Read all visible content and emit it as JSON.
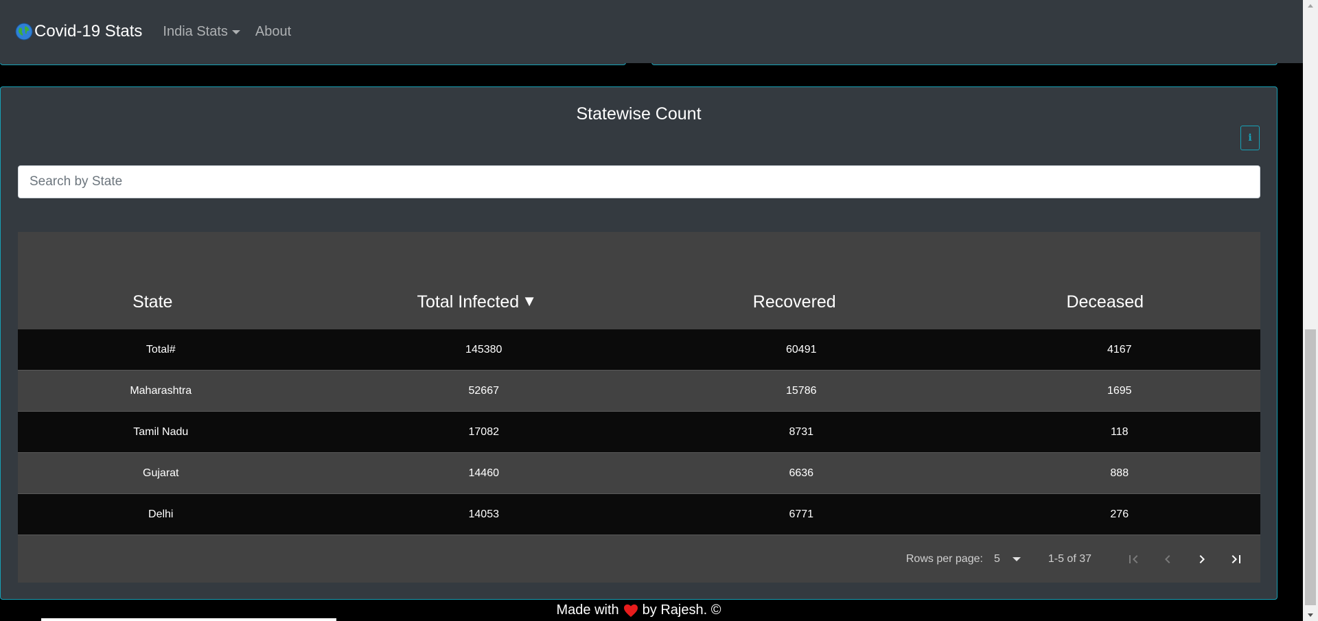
{
  "navbar": {
    "brand": "Covid-19 Stats",
    "items": [
      {
        "label": "India Stats",
        "dropdown": true
      },
      {
        "label": "About",
        "dropdown": false
      }
    ]
  },
  "card": {
    "title": "Statewise Count",
    "info_label": "i",
    "search_placeholder": "Search by State"
  },
  "table": {
    "columns": [
      "State",
      "Total Infected",
      "Recovered",
      "Deceased"
    ],
    "sort_indicator": "▼",
    "rows": [
      [
        "Total#",
        "145380",
        "60491",
        "4167"
      ],
      [
        "Maharashtra",
        "52667",
        "15786",
        "1695"
      ],
      [
        "Tamil Nadu",
        "17082",
        "8731",
        "118"
      ],
      [
        "Gujarat",
        "14460",
        "6636",
        "888"
      ],
      [
        "Delhi",
        "14053",
        "6771",
        "276"
      ]
    ]
  },
  "pagination": {
    "rows_per_page_label": "Rows per page:",
    "rows_per_page": "5",
    "range": "1-5 of 37"
  },
  "footer": {
    "prefix": "Made with",
    "suffix": "by Rajesh. ©"
  },
  "colors": {
    "accent": "#17a2b8",
    "navbar_bg": "#343a40",
    "table_bg": "#424242",
    "row_dark": "#0b0b0b",
    "heart": "#e81c1c"
  },
  "icons": [
    "globe-icon",
    "caret-down-icon",
    "info-icon",
    "sort-desc-icon",
    "first-page-icon",
    "prev-page-icon",
    "next-page-icon",
    "last-page-icon",
    "heart-icon"
  ]
}
